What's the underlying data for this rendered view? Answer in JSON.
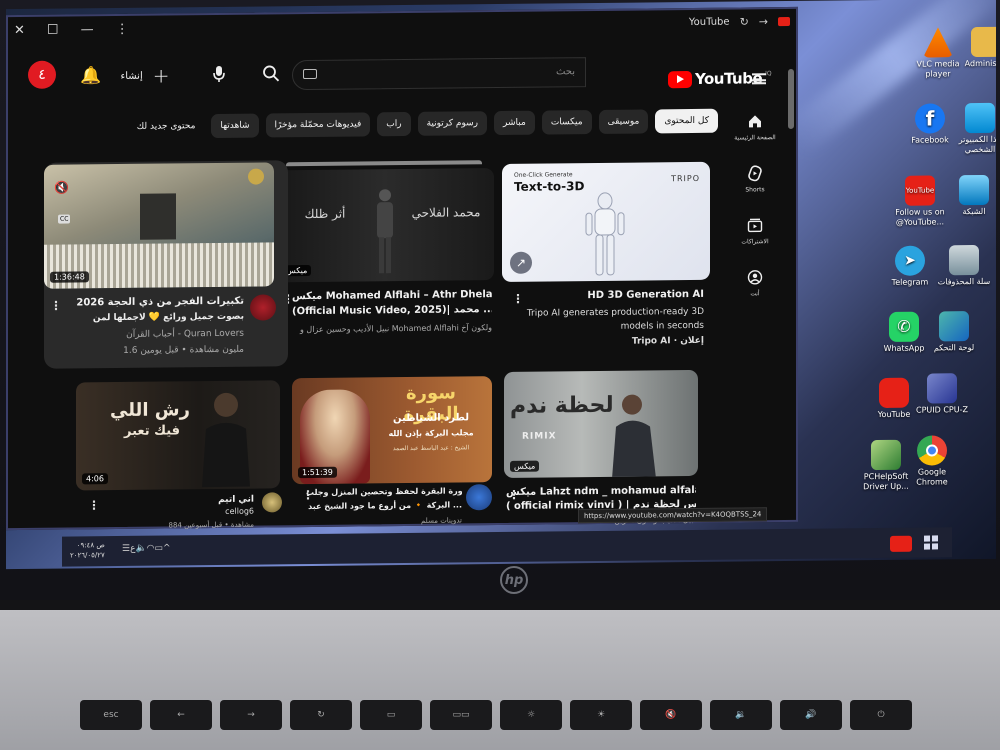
{
  "window": {
    "tab_title": "YouTube",
    "controls": [
      "✕",
      "☐",
      "—",
      "⋮"
    ]
  },
  "header": {
    "notification_count": "٤",
    "create_label": "إنشاء",
    "search_placeholder": "بحث",
    "logo_text": "YouTube",
    "logo_country": "IQ"
  },
  "sidenav": [
    {
      "label": "الصفحة الرئيسية",
      "icon": "home-icon"
    },
    {
      "label": "Shorts",
      "icon": "shorts-icon"
    },
    {
      "label": "الاشتراكات",
      "icon": "subscriptions-icon"
    },
    {
      "label": "أنت",
      "icon": "you-icon"
    }
  ],
  "chips": [
    {
      "label": "كل المحتوى",
      "active": true
    },
    {
      "label": "موسيقى",
      "active": false
    },
    {
      "label": "ميكسات",
      "active": false
    },
    {
      "label": "مباشر",
      "active": false
    },
    {
      "label": "رسوم كرتونية",
      "active": false
    },
    {
      "label": "راب",
      "active": false
    },
    {
      "label": "فيديوهات محمّلة مؤخرًا",
      "active": false
    },
    {
      "label": "شاهدتها",
      "active": false
    },
    {
      "label": "محتوى جديد لك",
      "active": false
    }
  ],
  "videos": [
    {
      "title": "HD 3D Generation AI",
      "sub1": "Tripo AI generates production-ready 3D",
      "sub2": "models in seconds",
      "channel": "Tripo AI · إعلان",
      "thumb_text_1": "One-Click Generate",
      "thumb_text_2": "Text-to-3D",
      "thumb_brand": "TRIPO"
    },
    {
      "title": "ميكس Mohamed Alflahi – Athr Dhelak",
      "sub1": "(Official Music Video, 2025)| محمد ...",
      "sub2": "نبيل الأديب وحسين عزال و Mohamed Alflahi ولكون آخ",
      "channel": "",
      "thumb_text_1": "محمد الفلاحي",
      "thumb_text_2": "أثر ظلك",
      "thumb_badge": "ميكس"
    },
    {
      "title": "تكبيرات الفجر من ذي الحجة 2026",
      "sub1": "بصوت جميل ورائع 💛 لاجملها لمن",
      "sub2": "أحباب القرآن - Quran Lovers",
      "channel": "1.6 مليون مشاهدة • قبل يومين",
      "duration": "1:36:48"
    },
    {
      "title": "ميكس Lahzt ndm _ mohamud alfalahi",
      "sub1": "( official rimix vinvi ) | ميكس لحظة ندم ...",
      "sub2": "نبيل الأديب ولكون آخرين",
      "channel": "",
      "thumb_text_1": "لحظة ندم",
      "thumb_text_2": "RIMIX",
      "thumb_badge": "ميكس"
    },
    {
      "title": "سورة البقرة لحفظ وتحصين المنزل وجلب",
      "sub1": "البركة 🔸 من أروع ما جود الشيخ عبد ...",
      "sub2": "تدوينات مسلم",
      "channel": "",
      "duration": "1:51:39",
      "thumb_text_1": "سورة البقرة",
      "thumb_text_2": "لطرد الشياطين",
      "thumb_text_3": "مجلب البركة بإذن الله",
      "thumb_text_4": "الشيخ : عبد الباسط عبد الصمد"
    },
    {
      "title": "اني اتيم",
      "sub1": "cellog6",
      "sub2": "884 مشاهدة • قبل أسبوعين",
      "channel": "",
      "duration": "4:06",
      "thumb_text_1": "رش اللي",
      "thumb_text_2": "فيك تعبر"
    }
  ],
  "status_url": "https://www.youtube.com/watch?v=K4OQBTSS_24",
  "taskbar": {
    "time": "ص ٠٩:٤٨",
    "date": "٢٠٢٦/٠٥/٢٧"
  },
  "desktop_icons": [
    {
      "label": "VLC media player"
    },
    {
      "label": "Administ..."
    },
    {
      "label": "Facebook"
    },
    {
      "label": "هذا الكمبيوتر الشخصي"
    },
    {
      "label": "Follow us on @YouTube..."
    },
    {
      "label": "الشبكة"
    },
    {
      "label": "Telegram"
    },
    {
      "label": "سلة المحذوفات"
    },
    {
      "label": "WhatsApp"
    },
    {
      "label": "لوحة التحكم"
    },
    {
      "label": "YouTube"
    },
    {
      "label": "CPUID CPU-Z"
    },
    {
      "label": "PCHelpSoft Driver Up..."
    },
    {
      "label": "Google Chrome"
    }
  ],
  "keyboard": {
    "esc": "esc",
    "logo": "hp"
  },
  "colors": {
    "yt_red": "#ff0000",
    "bg_dark": "#0f0f0f",
    "chip_bg": "#272727",
    "chip_active": "#f1f1f1"
  }
}
